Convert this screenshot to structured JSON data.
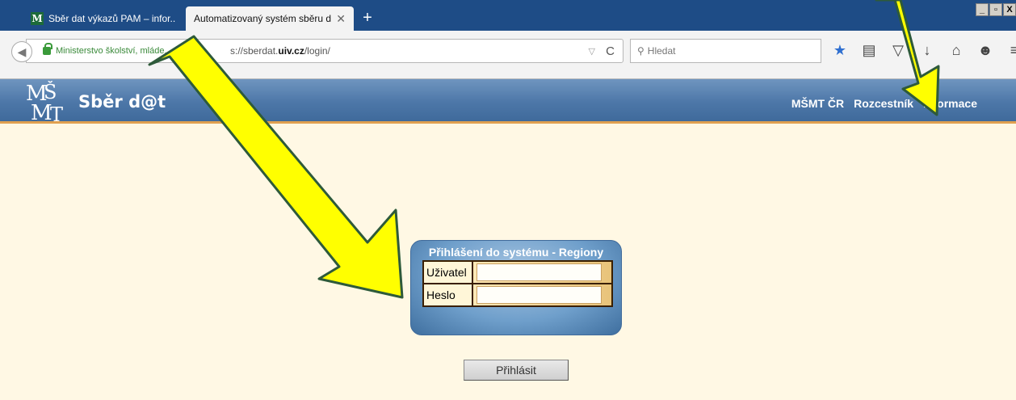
{
  "browser": {
    "tabs": [
      {
        "label": "Sběr dat výkazů PAM – infor...",
        "favicon": "M",
        "active": false
      },
      {
        "label": "Automatizovaný systém sběru dat",
        "active": true
      }
    ],
    "new_tab_label": "+",
    "window_buttons": [
      "_",
      " ",
      "X"
    ],
    "site_identity": "Ministerstvo školství, mláde...",
    "url_prefix": "s://sberdat.",
    "url_domain": "uiv.cz",
    "url_path": "/login/",
    "search_placeholder": "Hledat",
    "toolbar_icons": [
      "star-icon",
      "reading-list-icon",
      "pocket-icon",
      "download-icon",
      "home-icon",
      "smiley-icon",
      "menu-icon"
    ]
  },
  "site": {
    "title": "Sběr d@t",
    "nav": [
      "MŠMT ČR",
      "Rozcestník",
      "Informace"
    ]
  },
  "login": {
    "title": "Přihlášení do systému - Regiony",
    "user_label": "Uživatel",
    "user_value": "",
    "password_label": "Heslo",
    "password_value": "",
    "submit_label": "Přihlásit"
  },
  "colors": {
    "tabstrip": "#1e4c86",
    "header": "#4d77a8",
    "page_background": "#fff8e4",
    "arrow_fill": "#ffff00",
    "arrow_outline": "#2e5a3a"
  }
}
